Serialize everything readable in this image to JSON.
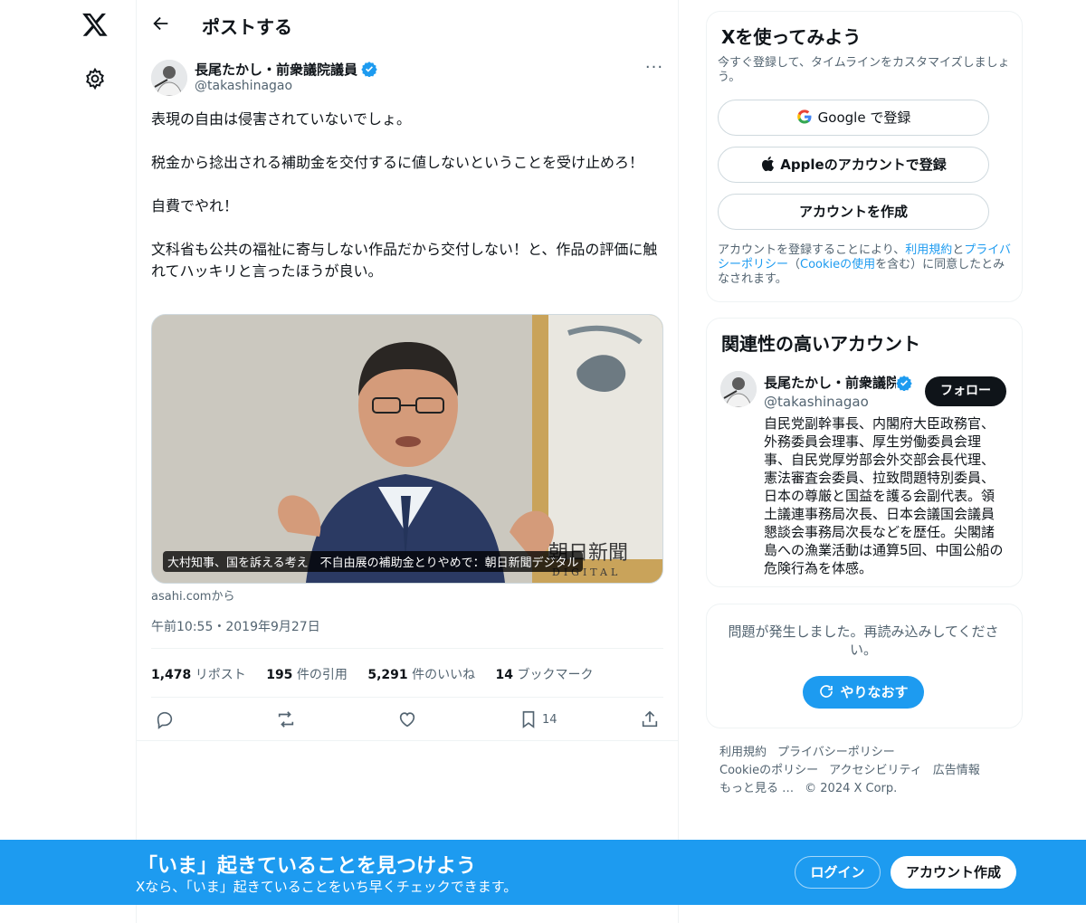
{
  "nav": {
    "logo_icon": "x-logo-icon",
    "settings_icon": "gear-icon"
  },
  "header": {
    "title": "ポストする",
    "back_icon": "arrow-left-icon"
  },
  "post": {
    "author_name": "長尾たかし・前衆議院議員",
    "author_handle": "@takashinagao",
    "more_label": "···",
    "text": [
      "表現の自由は侵害されていないでしょ。",
      "税金から捻出される補助金を交付するに値しないということを受け止めろ！",
      "自費でやれ！",
      "文科省も公共の福祉に寄与しない作品だから交付しない！と、作品の評価に触れてハッキリと言ったほうが良い。"
    ],
    "media_caption": "大村知事、国を訴える考え　不自由展の補助金とりやめで：朝日新聞デジタル",
    "media_watermark": "朝日新聞",
    "media_watermark_sub": "DIGITAL",
    "source": "asahi.comから",
    "timestamp": "午前10:55・2019年9月27日",
    "stats": {
      "reposts_num": "1,478",
      "reposts_label": "リポスト",
      "quotes_num": "195",
      "quotes_label": "件の引用",
      "likes_num": "5,291",
      "likes_label": "件のいいね",
      "bookmarks_num": "14",
      "bookmarks_label": "ブックマーク"
    },
    "bookmark_count": "14"
  },
  "signup": {
    "title": "Xを使ってみよう",
    "subtitle": "今すぐ登録して、タイムラインをカスタマイズしましょう。",
    "google_label": "Google で登録",
    "apple_label": "Appleのアカウントで登録",
    "create_label": "アカウントを作成",
    "legal_1": "アカウントを登録することにより、",
    "legal_terms": "利用規約",
    "legal_and": "と",
    "legal_privacy": "プライバシーポリシー",
    "legal_2": "（",
    "legal_cookie": "Cookieの使用",
    "legal_3": "を含む）に同意したとみなされます。"
  },
  "related": {
    "title": "関連性の高いアカウント",
    "name": "長尾たかし・前衆議院議員",
    "handle": "@takashinagao",
    "follow_label": "フォロー",
    "bio": "自民党副幹事長、内閣府大臣政務官、外務委員会理事、厚生労働委員会理事、自民党厚労部会外交部会長代理、憲法審査会委員、拉致問題特別委員、日本の尊厳と国益を護る会副代表。領土議連事務局次長、日本会議国会議員懇談会事務局次長などを歴任。尖閣諸島への漁業活動は通算5回、中国公船の危険行為を体感。"
  },
  "error_card": {
    "message": "問題が発生しました。再読み込みしてください。",
    "retry_label": "やりなおす"
  },
  "footer": {
    "links": [
      "利用規約",
      "プライバシーポリシー",
      "Cookieのポリシー",
      "アクセシビリティ",
      "広告情報",
      "もっと見る …",
      "© 2024 X Corp."
    ]
  },
  "banner": {
    "title": "「いま」起きていることを見つけよう",
    "subtitle": "Xなら、「いま」起きていることをいち早くチェックできます。",
    "login_label": "ログイン",
    "signup_label": "アカウント作成"
  },
  "colors": {
    "accent": "#1d9bf0",
    "text": "#0f1419",
    "muted": "#536471",
    "border": "#eff3f4"
  }
}
